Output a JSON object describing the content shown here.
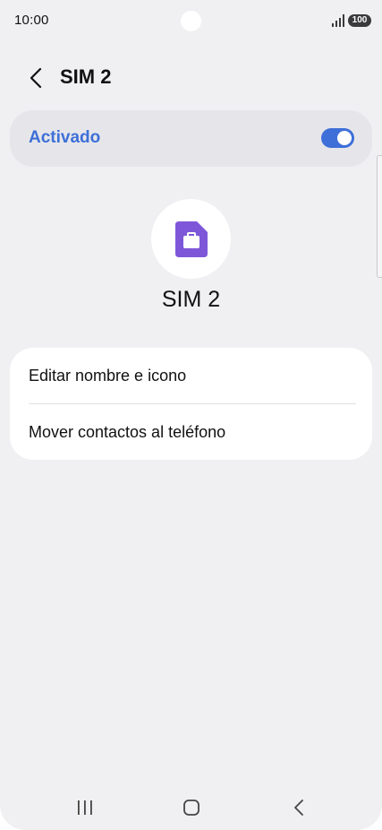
{
  "status_bar": {
    "time": "10:00",
    "battery": "100",
    "signal_icon": "signal-bars-icon"
  },
  "header": {
    "title": "SIM 2",
    "back_icon": "chevron-left-icon"
  },
  "toggle": {
    "label": "Activado",
    "state": "on",
    "accent_color": "#3e6fd8"
  },
  "sim": {
    "name": "SIM 2",
    "icon": "sim-card-briefcase-icon",
    "icon_color": "#7e57d8"
  },
  "options": [
    {
      "label": "Editar nombre e icono"
    },
    {
      "label": "Mover contactos al teléfono"
    }
  ],
  "nav_bar": {
    "recents_icon": "recents-icon",
    "home_icon": "home-icon",
    "back_icon": "back-icon"
  }
}
